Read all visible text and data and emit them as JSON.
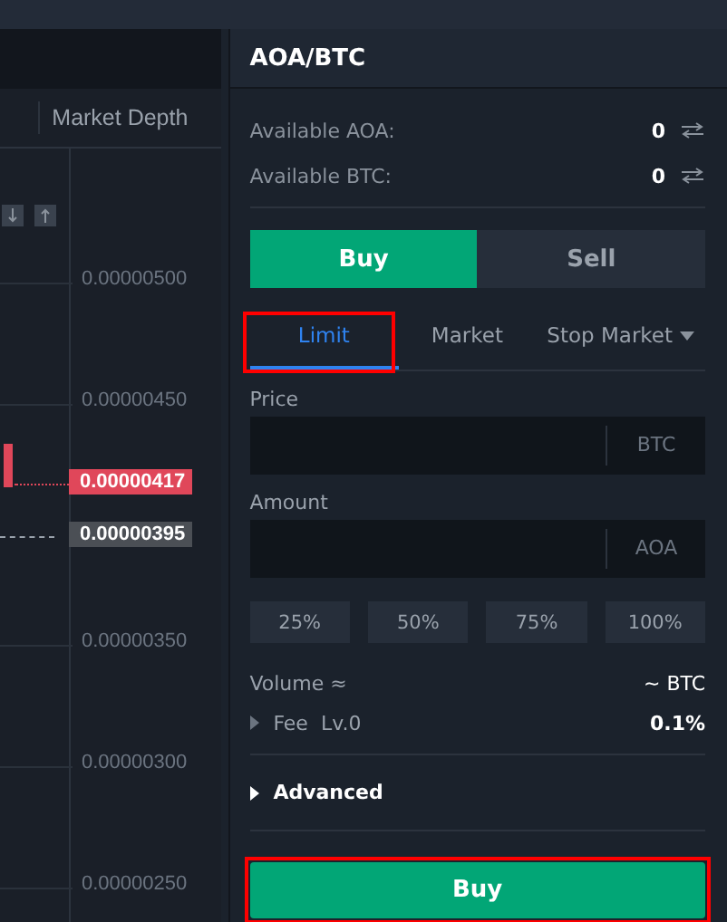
{
  "chart": {
    "tab": "Market Depth",
    "axis_ticks": [
      "0.00000500",
      "0.00000450",
      "0.00000350",
      "0.00000300",
      "0.00000250"
    ],
    "last_price": {
      "label": "0.00000417"
    },
    "ref_price": {
      "label": "0.00000395"
    }
  },
  "panel": {
    "title": "AOA/BTC",
    "balances": [
      {
        "label": "Available AOA:",
        "value": "0"
      },
      {
        "label": "Available BTC:",
        "value": "0"
      }
    ],
    "sides": [
      {
        "label": "Buy",
        "selected": true
      },
      {
        "label": "Sell",
        "selected": false
      }
    ],
    "order_types": [
      {
        "label": "Limit",
        "selected": true,
        "highlighted": true,
        "dropdown": false
      },
      {
        "label": "Market",
        "selected": false,
        "highlighted": false,
        "dropdown": false
      },
      {
        "label": "Stop Market",
        "selected": false,
        "highlighted": false,
        "dropdown": true
      }
    ],
    "fields": [
      {
        "label": "Price",
        "unit": "BTC"
      },
      {
        "label": "Amount",
        "unit": "AOA"
      }
    ],
    "percent_buttons": [
      "25%",
      "50%",
      "75%",
      "100%"
    ],
    "volume": {
      "label": "Volume ≈",
      "value": "~ BTC"
    },
    "fee": {
      "label": "Fee  Lv.0",
      "value": "0.1%",
      "expanded": false
    },
    "advanced": {
      "label": "Advanced",
      "expanded": false
    },
    "submit": {
      "label": "Buy",
      "highlighted": true
    }
  }
}
